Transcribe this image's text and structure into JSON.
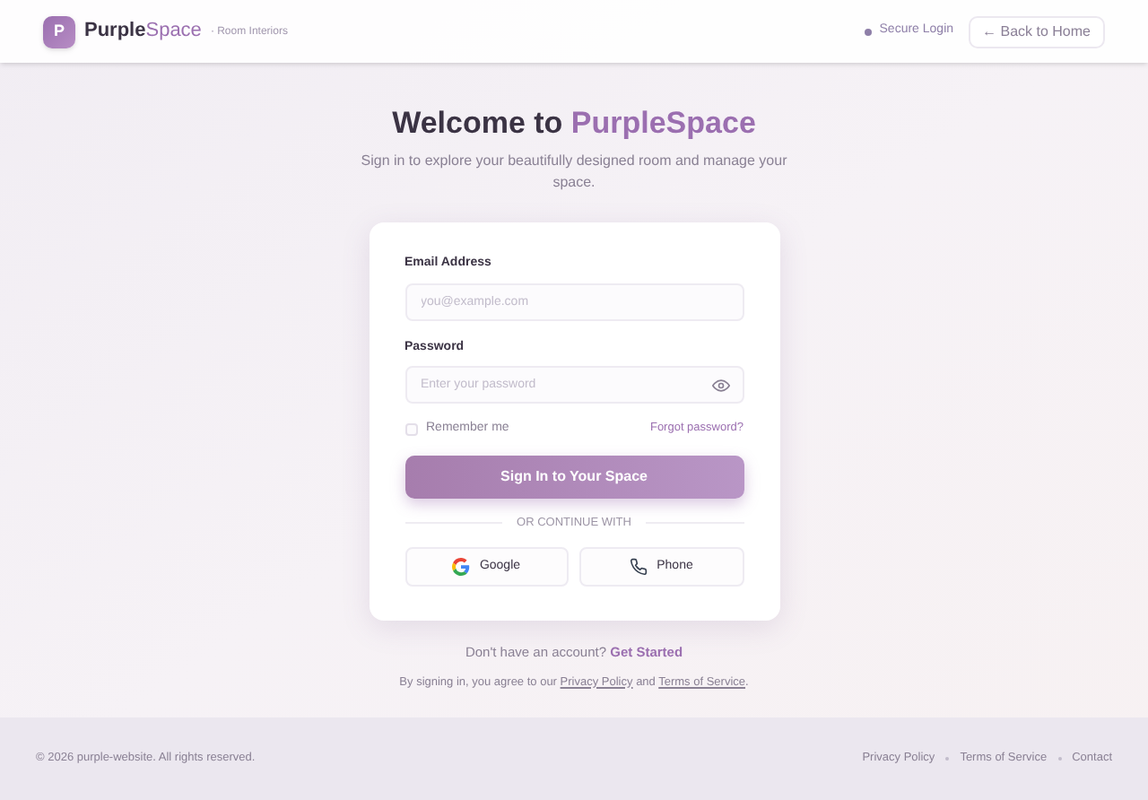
{
  "header": {
    "logo_letter": "P",
    "brand": "Purple",
    "brand_accent": "Space",
    "tagline": "· Room Interiors",
    "secure_label": "Secure Login",
    "back_button": "← Back to Home"
  },
  "hero": {
    "title": "Welcome to ",
    "title_accent": "PurpleSpace",
    "subtitle": "Sign in to explore your beautifully designed room and manage your space."
  },
  "form": {
    "email": {
      "label": "Email Address",
      "placeholder": "you@example.com"
    },
    "password": {
      "label": "Password",
      "placeholder": "Enter your password"
    },
    "remember": {
      "label": "Remember me",
      "checked": false
    },
    "forgot_link": "Forgot password?",
    "submit": "Sign In to Your Space",
    "divider": "OR CONTINUE WITH",
    "alternatives": [
      {
        "kind": "google",
        "label": "Google"
      },
      {
        "kind": "phone",
        "label": "Phone"
      }
    ]
  },
  "signup": {
    "prompt": "Don't have an account? ",
    "link": "Get Started"
  },
  "terms": {
    "prefix": "By signing in, you agree to our ",
    "privacy": "Privacy Policy",
    "middle": " and ",
    "terms": "Terms of Service",
    "suffix": "."
  },
  "footer": {
    "copyright": "© 2026 purple-website. All rights reserved.",
    "links": [
      "Privacy Policy",
      "Terms of Service",
      "Contact"
    ]
  }
}
